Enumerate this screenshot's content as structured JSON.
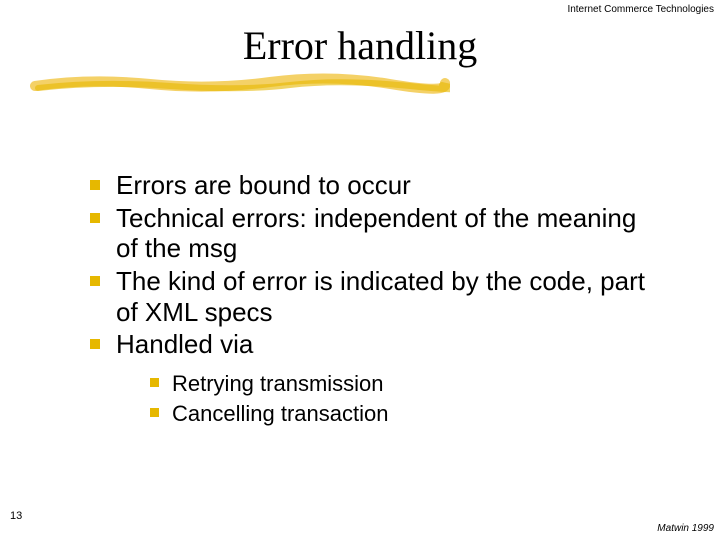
{
  "header": {
    "label": "Internet Commerce Technologies"
  },
  "title": "Error handling",
  "bullets": [
    {
      "text": "Errors are bound to occur"
    },
    {
      "text": "Technical errors: independent of the meaning of the msg"
    },
    {
      "text": "The kind of error is indicated by the code, part of XML specs"
    },
    {
      "text": "Handled via"
    }
  ],
  "sub_bullets": [
    {
      "text": "Retrying transmission"
    },
    {
      "text": "Cancelling transaction"
    }
  ],
  "footer": {
    "page_number": "13",
    "credit": "Matwin 1999"
  },
  "colors": {
    "accent": "#e6b800"
  }
}
